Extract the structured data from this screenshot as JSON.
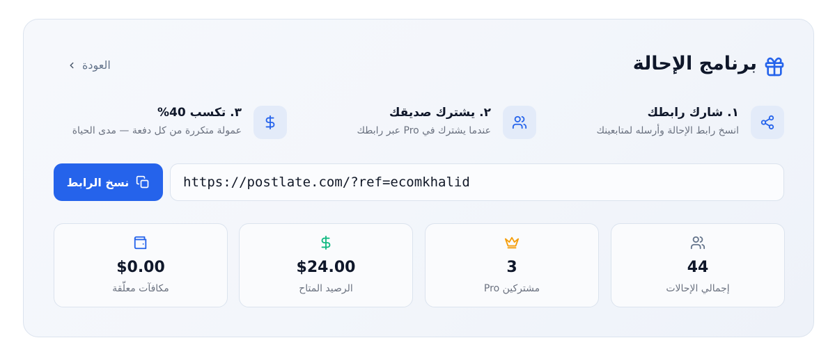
{
  "header": {
    "title": "برنامج الإحالة",
    "back_label": "العودة"
  },
  "steps": [
    {
      "title": "١. شارك رابطك",
      "description": "انسخ رابط الإحالة وأرسله لمتابعينك",
      "icon": "share-icon"
    },
    {
      "title": "٢. يشترك صديقك",
      "description": "عندما يشترك في Pro عبر رابطك",
      "icon": "users-icon"
    },
    {
      "title": "٣. تكسب 40%",
      "description": "عمولة متكررة من كل دفعة — مدى الحياة",
      "icon": "dollar-icon"
    }
  ],
  "referral": {
    "link": "https://postlate.com/?ref=ecomkhalid",
    "copy_label": "نسخ الرابط"
  },
  "stats": [
    {
      "value": "44",
      "label": "إجمالي الإحالات",
      "icon": "users-icon"
    },
    {
      "value": "3",
      "label": "مشتركين Pro",
      "icon": "crown-icon"
    },
    {
      "value": "$24.00",
      "label": "الرصيد المتاح",
      "icon": "dollar-icon"
    },
    {
      "value": "$0.00",
      "label": "مكافآت معلّقة",
      "icon": "wallet-icon"
    }
  ],
  "colors": {
    "primary": "#2563eb",
    "crown": "#f59e0b",
    "money": "#10b981",
    "muted": "#6b7280"
  }
}
